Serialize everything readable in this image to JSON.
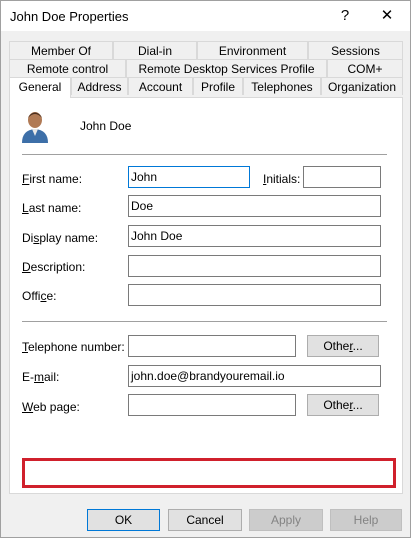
{
  "window": {
    "title": "John Doe Properties",
    "help_glyph": "?",
    "close_glyph": "✕"
  },
  "tabs": {
    "row1": [
      "Member Of",
      "Dial-in",
      "Environment",
      "Sessions"
    ],
    "row2": [
      "Remote control",
      "Remote Desktop Services Profile",
      "COM+"
    ],
    "row3": [
      "General",
      "Address",
      "Account",
      "Profile",
      "Telephones",
      "Organization"
    ]
  },
  "user": {
    "display": "John Doe"
  },
  "fields": {
    "first_name": {
      "label_u": "F",
      "label_rest": "irst name:",
      "value": "John"
    },
    "initials": {
      "label_u": "I",
      "label_rest": "nitials:",
      "value": ""
    },
    "last_name": {
      "label_u": "L",
      "label_rest": "ast name:",
      "value": "Doe"
    },
    "display_name": {
      "label_pre": "Di",
      "label_u": "s",
      "label_rest": "play name:",
      "value": "John Doe"
    },
    "description": {
      "label_u": "D",
      "label_rest": "escription:",
      "value": ""
    },
    "office": {
      "label_pre": "Offi",
      "label_u": "c",
      "label_rest": "e:",
      "value": ""
    },
    "telephone": {
      "label_u": "T",
      "label_rest": "elephone number:",
      "value": ""
    },
    "email": {
      "label_pre": "E-",
      "label_u": "m",
      "label_rest": "ail:",
      "value": "john.doe@brandyouremail.io"
    },
    "web_page": {
      "label_u": "W",
      "label_rest": "eb page:",
      "value": ""
    }
  },
  "buttons": {
    "other_tel": {
      "pre": "Othe",
      "u": "r",
      "rest": "..."
    },
    "other_web": {
      "pre": "Othe",
      "u": "r",
      "rest": "..."
    },
    "ok": "OK",
    "cancel": "Cancel",
    "apply": "Apply",
    "help": "Help"
  },
  "colors": {
    "highlight": "#d0202c",
    "focus": "#0078d7"
  },
  "icons": {
    "user_avatar": "user-avatar-icon"
  }
}
